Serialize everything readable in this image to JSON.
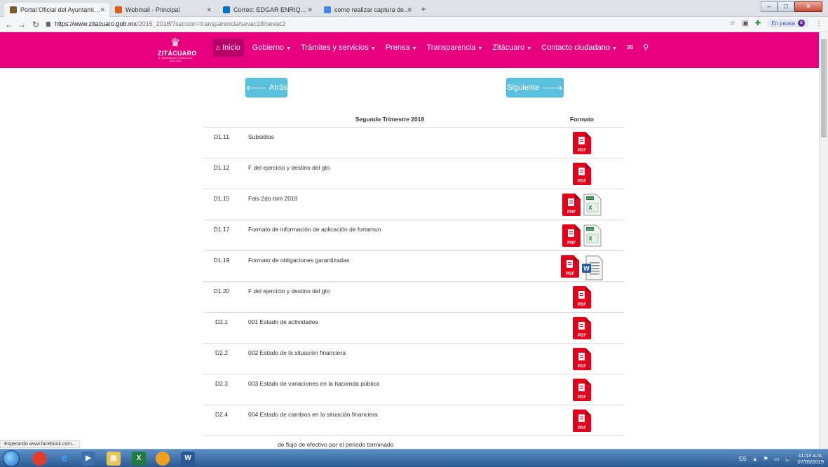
{
  "browser": {
    "tabs": [
      {
        "label": "Portal Oficial del Ayuntamiento d",
        "active": true,
        "favicon_color": "#7a5a2a"
      },
      {
        "label": "Webmail - Principal",
        "active": false,
        "favicon_color": "#e05a1a"
      },
      {
        "label": "Correo: EDGAR ENRIQUE RAMIR",
        "active": false,
        "favicon_color": "#0072c6"
      },
      {
        "label": "como realizar captura de pantall",
        "active": false,
        "favicon_color": "#4285f4"
      }
    ],
    "url_host": "https://www.zitacuaro.gob.mx",
    "url_path": "/2015_2018/?seccion=transparencia/sevac18/sevac2",
    "pause_label": "En pausa",
    "profile_initial": "a"
  },
  "header": {
    "logo_text": "ZITÁCUARO",
    "logo_tagline": "H. Ayuntamiento Constitucional 2015-2018",
    "menu": [
      {
        "label": "Inicio",
        "active": true,
        "caret": false,
        "icon": "home-icon"
      },
      {
        "label": "Gobierno",
        "caret": true
      },
      {
        "label": "Trámites y servicios",
        "caret": true
      },
      {
        "label": "Prensa",
        "caret": true
      },
      {
        "label": "Transparencia",
        "caret": true
      },
      {
        "label": "Zitácuaro",
        "caret": true
      },
      {
        "label": "Contacto ciudadano",
        "caret": true
      }
    ],
    "accent_color": "#e6007e"
  },
  "nav": {
    "back_label": "Atrás",
    "next_label": "Siguiente"
  },
  "table": {
    "header_title": "Segundo Trimestre 2018",
    "header_format": "Formato",
    "rows": [
      {
        "code": "D1.11",
        "title": "Subsidios",
        "formats": [
          "pdf"
        ]
      },
      {
        "code": "D1.12",
        "title": "F del ejercicio y destino del gto",
        "formats": [
          "pdf"
        ]
      },
      {
        "code": "D1.15",
        "title": "Fais 2do trim 2018",
        "formats": [
          "pdf",
          "xlsx"
        ]
      },
      {
        "code": "D1.17",
        "title": "Formato de información de aplicación de fortamun",
        "formats": [
          "pdf",
          "xlsx"
        ]
      },
      {
        "code": "D1.19",
        "title": "Formato de obligaciones garantizadas",
        "formats": [
          "pdf",
          "docx"
        ]
      },
      {
        "code": "D1.20",
        "title": "F del ejercicio y destino del gto",
        "formats": [
          "pdf"
        ]
      },
      {
        "code": "D2.1",
        "title": "001 Estado de actividades",
        "formats": [
          "pdf"
        ]
      },
      {
        "code": "D2.2",
        "title": "002 Estado de la situación financiera",
        "formats": [
          "pdf"
        ]
      },
      {
        "code": "D2.3",
        "title": "003 Estado de variaciones en la hacienda pública",
        "formats": [
          "pdf"
        ]
      },
      {
        "code": "D2.4",
        "title": "004 Estado de cambios en la situación financiera",
        "formats": [
          "pdf"
        ]
      }
    ],
    "partial_row_text": "de flujo de efectivo por el periodo terminado"
  },
  "status": {
    "text": "Esperando www.facebook.com..."
  },
  "taskbar": {
    "language": "ES",
    "time": "11:43 a.m.",
    "date": "07/05/2019"
  }
}
